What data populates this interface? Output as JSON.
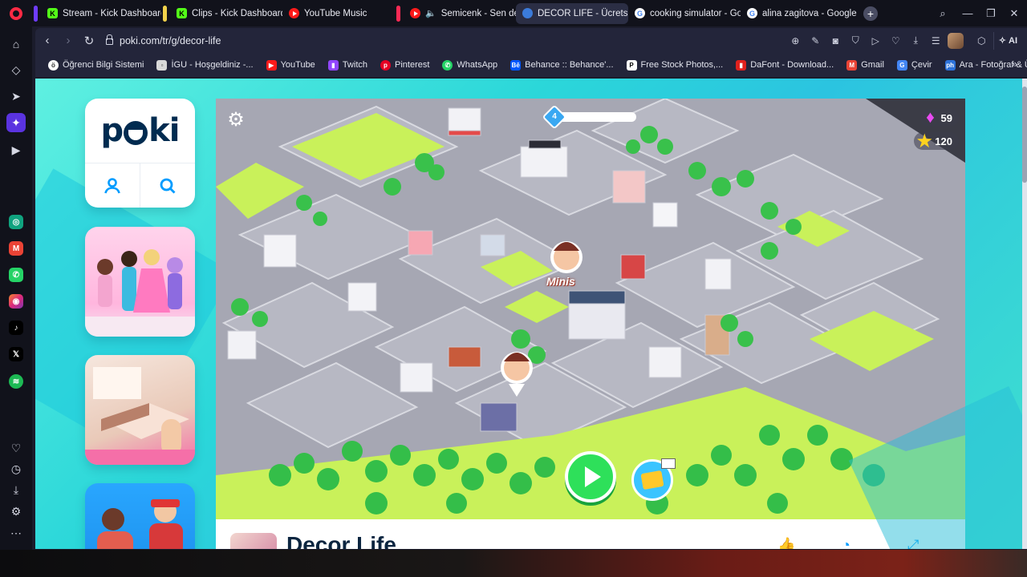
{
  "tabs": [
    {
      "label": "Stream - Kick Dashboard",
      "favicon": "kick-icon",
      "accent": "#6f3cff"
    },
    {
      "label": "Clips - Kick Dashboard",
      "favicon": "kick-icon",
      "accent": "#f2d24b"
    },
    {
      "label": "YouTube Music",
      "favicon": "youtube-music-icon"
    },
    {
      "label": "Semicenk - Sen de Bir",
      "favicon": "youtube-icon",
      "accent": "#ff2a55"
    },
    {
      "label": "DECOR LIFE - Ücretsiz Onl",
      "favicon": "poki-icon",
      "active": true
    },
    {
      "label": "cooking simulator - Goog",
      "favicon": "google-icon"
    },
    {
      "label": "alina zagitova - Google'da",
      "favicon": "google-icon"
    }
  ],
  "window_controls": [
    "search-icon",
    "minimize-icon",
    "restore-icon",
    "close-icon"
  ],
  "address": {
    "url": "poki.com/tr/g/decor-life",
    "ai_label": "AI"
  },
  "bookmarks": [
    {
      "label": "Öğrenci Bilgi Sistemi",
      "color": "#ffffff"
    },
    {
      "label": "İGU - Hoşgeldiniz -...",
      "color": "#ffffff"
    },
    {
      "label": "YouTube",
      "color": "#ff1a1a"
    },
    {
      "label": "Twitch",
      "color": "#9146ff"
    },
    {
      "label": "Pinterest",
      "color": "#e60023"
    },
    {
      "label": "WhatsApp",
      "color": "#25d366"
    },
    {
      "label": "Behance :: Behance'...",
      "color": "#0057ff"
    },
    {
      "label": "Free Stock Photos,...",
      "color": "#ffffff"
    },
    {
      "label": "DaFont - Download...",
      "color": "#e0211d"
    },
    {
      "label": "Gmail",
      "color": "#ea4335"
    },
    {
      "label": "Çevir",
      "color": "#4285f4"
    },
    {
      "label": "Ara - Fotoğraf & Üc...",
      "color": "#2d72d9"
    }
  ],
  "poki": {
    "logo_prefix": "p",
    "logo_suffix": "ki"
  },
  "game": {
    "title": "Decor Life",
    "level": "4",
    "level_progress": 0.05,
    "gems": "59",
    "stars": "120",
    "map_label": "Minis"
  }
}
